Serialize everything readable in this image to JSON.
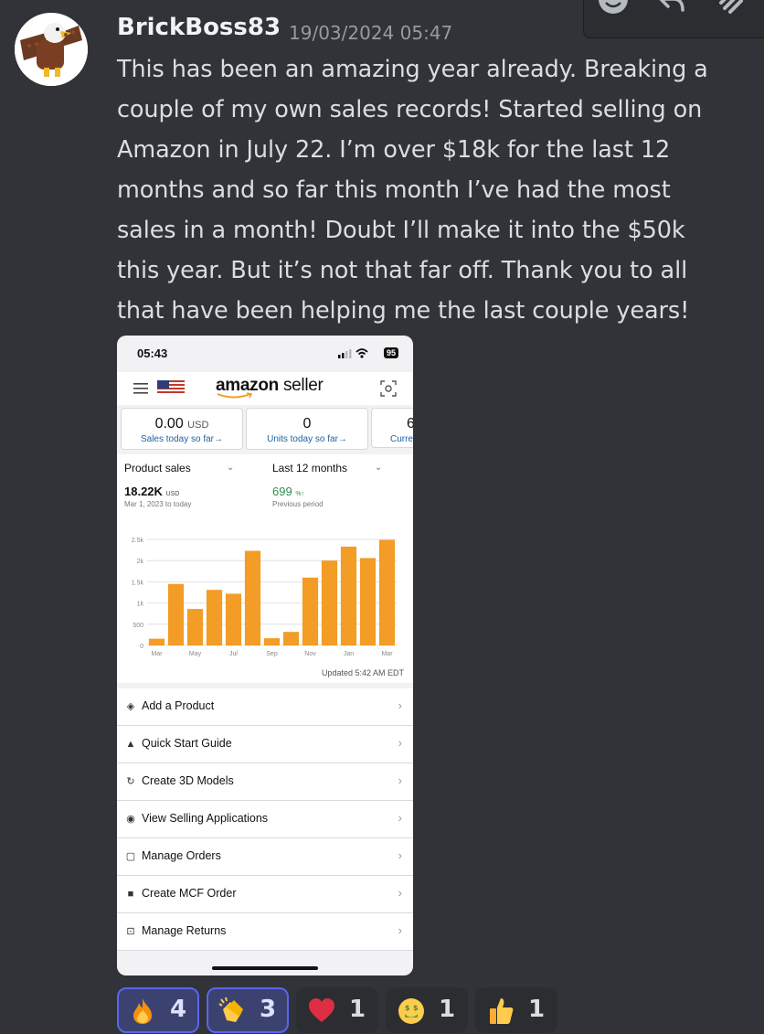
{
  "message": {
    "author": "BrickBoss83",
    "timestamp": "19/03/2024 05:47",
    "lines": [
      "This has been an amazing year already. Breaking a",
      "couple of my own sales records!  Started selling on",
      "Amazon in July 22. I’m over $18k for the last 12",
      "months and so far this month I’ve had the most",
      "sales in a month!  Doubt I’ll make it into the $50k",
      "this year. But it’s not that far off. Thank you to all",
      "that have been helping me the last couple years!"
    ]
  },
  "toolbar": {
    "icons": [
      "add-reaction-icon",
      "reply-icon",
      "more-icon"
    ]
  },
  "phone": {
    "time": "05:43",
    "battery": "95",
    "logo_main": "amazon",
    "logo_sub": "seller",
    "tiles": [
      {
        "value": "0.00",
        "unit": "USD",
        "sub": "Sales today so far→"
      },
      {
        "value": "0",
        "unit": "",
        "sub": "Units today so far→"
      },
      {
        "value": "6",
        "unit": "",
        "sub": "Curre"
      }
    ],
    "sales_dropdown": "Product sales",
    "period_dropdown": "Last 12 months",
    "sales_value": "18.22K",
    "sales_unit": "USD",
    "sales_range": "Mar 1, 2023 to today",
    "change_value": "699",
    "change_unit": "%↑",
    "change_label": "Previous period",
    "updated": "Updated 5:42 AM EDT",
    "menu": [
      {
        "label": "Add a Product",
        "icon": "tag-icon"
      },
      {
        "label": "Quick Start Guide",
        "icon": "graduation-cap-icon"
      },
      {
        "label": "Create 3D Models",
        "icon": "rotate-3d-icon"
      },
      {
        "label": "View Selling Applications",
        "icon": "eye-icon"
      },
      {
        "label": "Manage Orders",
        "icon": "clipboard-icon"
      },
      {
        "label": "Create MCF Order",
        "icon": "truck-icon"
      },
      {
        "label": "Manage Returns",
        "icon": "return-box-icon"
      }
    ]
  },
  "chart_data": {
    "type": "bar",
    "categories": [
      "Mar",
      "Apr",
      "May",
      "Jun",
      "Jul",
      "Aug",
      "Sep",
      "Oct",
      "Nov",
      "Dec",
      "Jan",
      "Feb",
      "Mar"
    ],
    "tick_labels": [
      "Mar",
      "May",
      "Jul",
      "Sep",
      "Nov",
      "Jan",
      "Mar"
    ],
    "values": [
      160,
      1450,
      860,
      1310,
      1220,
      2230,
      170,
      320,
      1600,
      2000,
      2330,
      2060,
      2490
    ],
    "y_ticks": [
      "0",
      "500",
      "1k",
      "1.5k",
      "2k",
      "2.5k"
    ],
    "ylim": [
      0,
      2500
    ],
    "bar_color": "#f39c26",
    "grid": true,
    "title": "",
    "xlabel": "",
    "ylabel": ""
  },
  "reactions": [
    {
      "emoji": "fire",
      "count": "4",
      "me": true
    },
    {
      "emoji": "clapping-hands",
      "count": "3",
      "me": true
    },
    {
      "emoji": "red-heart",
      "count": "1",
      "me": false
    },
    {
      "emoji": "money-mouth-face",
      "count": "1",
      "me": false
    },
    {
      "emoji": "thumbs-up",
      "count": "1",
      "me": false
    }
  ]
}
